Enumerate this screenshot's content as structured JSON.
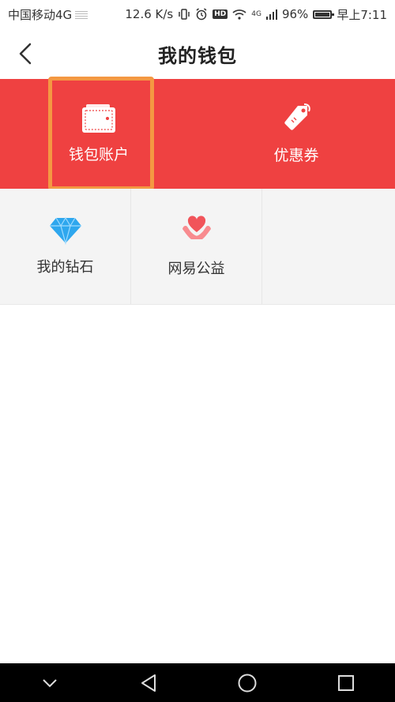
{
  "status_bar": {
    "carrier": "中国移动4G",
    "speed": "12.6 K/s",
    "hd": "HD",
    "network": "4G",
    "battery": "96%",
    "battery_level": 0.96,
    "time": "早上7:11"
  },
  "header": {
    "title": "我的钱包"
  },
  "banner": {
    "wallet_label": "钱包账户",
    "coupon_label": "优惠券",
    "background_color": "#ef4141",
    "highlight_color": "#f49842"
  },
  "grid": {
    "items": [
      {
        "label": "我的钻石",
        "icon": "diamond-icon"
      },
      {
        "label": "网易公益",
        "icon": "charity-heart-icon"
      }
    ]
  },
  "nav": {
    "icons": [
      "chevron-down-icon",
      "back-triangle-icon",
      "home-circle-icon",
      "recents-square-icon"
    ]
  }
}
